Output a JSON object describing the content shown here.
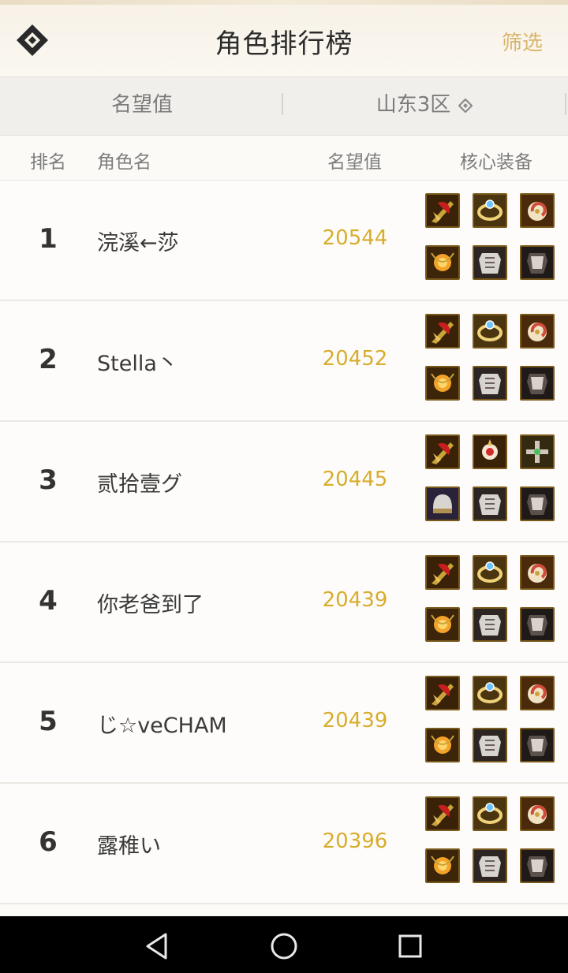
{
  "header": {
    "title": "角色排行榜",
    "filter_label": "筛选",
    "logo_icon": "diamond-logo-icon"
  },
  "tabs": {
    "metric": "名望值",
    "server": "山东3区",
    "server_dropdown_icon": "diamond-chevron-icon"
  },
  "columns": {
    "rank": "排名",
    "name": "角色名",
    "score": "名望值",
    "equipment": "核心装备"
  },
  "rows": [
    {
      "rank": "1",
      "name": "浣溪←莎",
      "score": "20544",
      "equipment": [
        "red-dragon-weapon-icon",
        "blue-gem-ring-icon",
        "pearl-shell-icon",
        "amber-necklace-icon",
        "silver-armor-icon",
        "dark-armor-icon"
      ]
    },
    {
      "rank": "2",
      "name": "Stella丶",
      "score": "20452",
      "equipment": [
        "red-dragon-weapon-icon",
        "blue-gem-ring-icon",
        "pearl-shell-icon",
        "amber-necklace-icon",
        "silver-armor-icon",
        "dark-armor-icon"
      ]
    },
    {
      "rank": "3",
      "name": "贰拾壹グ",
      "score": "20445",
      "equipment": [
        "red-dragon-weapon-icon",
        "ruby-brooch-icon",
        "green-cross-icon",
        "silver-helm-icon",
        "silver-armor-icon",
        "dark-armor-icon"
      ]
    },
    {
      "rank": "4",
      "name": "你老爸到了",
      "score": "20439",
      "equipment": [
        "red-dragon-weapon-icon",
        "blue-gem-ring-icon",
        "pearl-shell-icon",
        "amber-necklace-icon",
        "silver-armor-icon",
        "dark-armor-icon"
      ]
    },
    {
      "rank": "5",
      "name": "じ☆veCHAM",
      "score": "20439",
      "equipment": [
        "red-dragon-weapon-icon",
        "blue-gem-ring-icon",
        "pearl-shell-icon",
        "amber-necklace-icon",
        "silver-armor-icon",
        "dark-armor-icon"
      ]
    },
    {
      "rank": "6",
      "name": "露稚い",
      "score": "20396",
      "equipment": [
        "red-dragon-weapon-icon",
        "blue-gem-ring-icon",
        "pearl-shell-icon",
        "amber-necklace-icon",
        "silver-armor-icon",
        "dark-armor-icon"
      ]
    }
  ],
  "colors": {
    "score": "#d7ad2c",
    "filter": "#d9b56b",
    "item_border": "#7a5a1c",
    "item_glow": "#e6c25a"
  },
  "navbar": {
    "icons": [
      "back-triangle-icon",
      "home-circle-icon",
      "recents-square-icon"
    ]
  }
}
